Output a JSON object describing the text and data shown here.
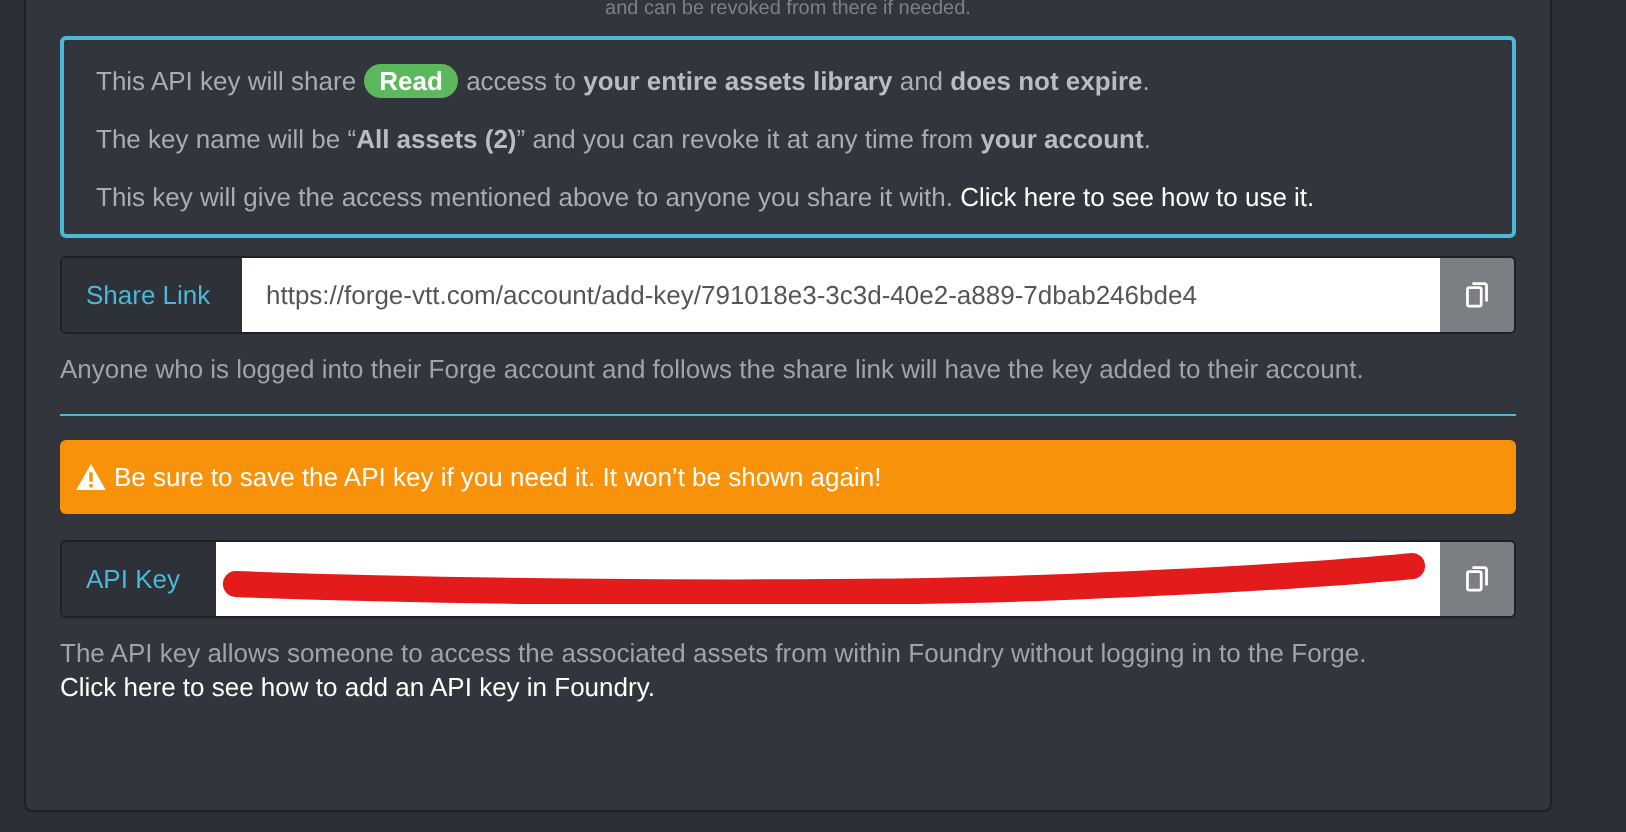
{
  "cut_note": "and can be revoked from there if needed.",
  "info": {
    "lines": [
      [
        {
          "kind": "text",
          "text": "This API key will share "
        },
        {
          "kind": "badge",
          "text": "Read",
          "color": "#5cb85c"
        },
        {
          "kind": "text",
          "text": " access to **your entire assets library** and **does not expire**."
        }
      ],
      [
        {
          "kind": "text",
          "text": "The key name will be “**All assets (2)**” and you can revoke it at any time from **your account**."
        }
      ],
      [
        {
          "kind": "text",
          "text": "This key will give the access mentioned above to anyone you share it with. "
        },
        {
          "kind": "link",
          "text": "Click here to see how to use it."
        }
      ]
    ]
  },
  "share_link": {
    "label": "Share Link",
    "value": "https://forge-vtt.com/account/add-key/791018e3-3c3d-40e2-a889-7dbab246bde4",
    "help": [
      {
        "kind": "text",
        "text": "Anyone who is logged into their Forge account and follows the share link will have the key added to their account."
      }
    ]
  },
  "warning": "Be sure to save the API key if you need it. It won’t be shown again!",
  "api_key": {
    "label": "API Key",
    "redacted": true,
    "help": [
      {
        "kind": "text",
        "text": "The API key allows someone to access the associated assets from within Foundry without logging in to the Forge. "
      },
      {
        "kind": "link",
        "text": "Click here to see how to add an API key in Foundry."
      }
    ]
  }
}
